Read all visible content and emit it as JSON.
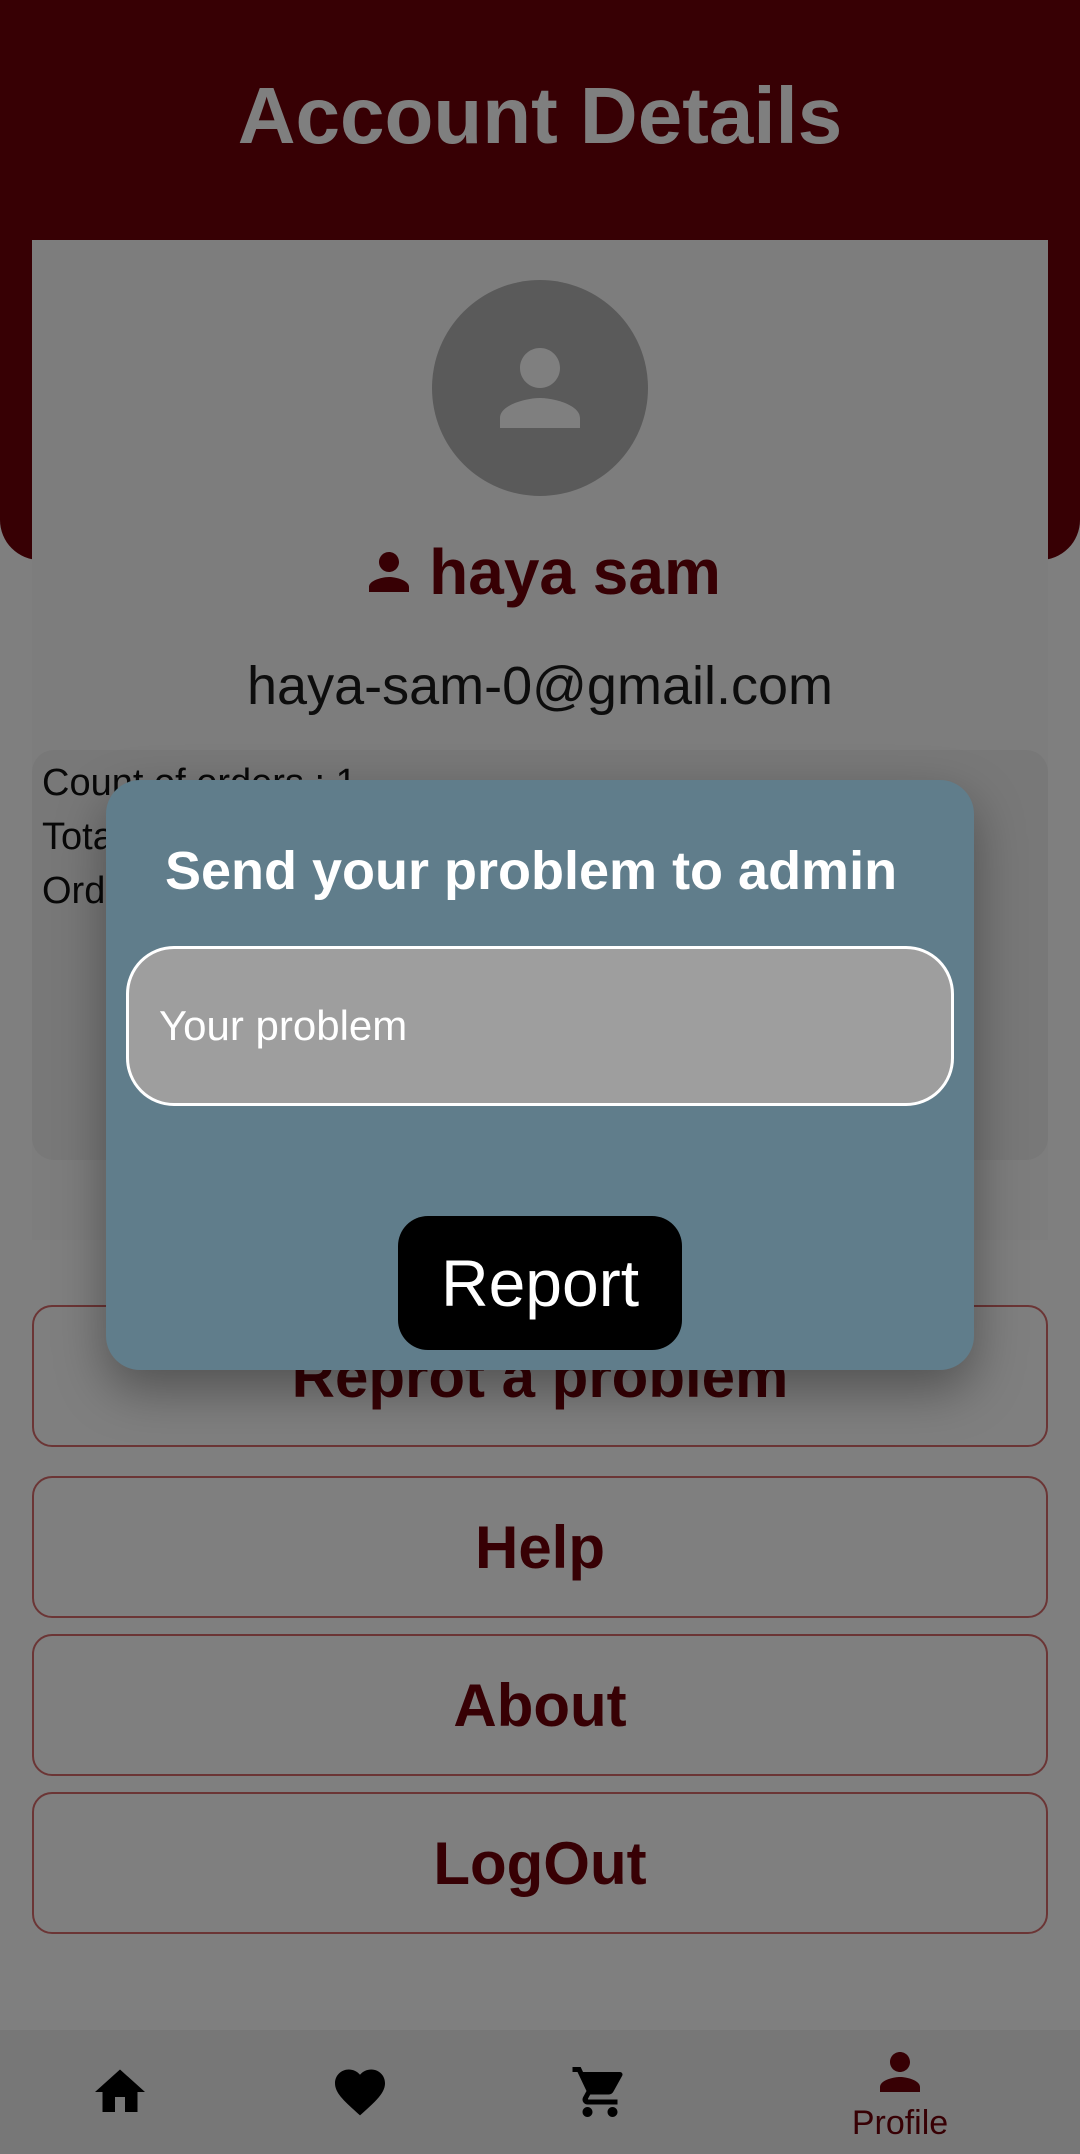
{
  "header": {
    "title": "Account Details"
  },
  "profile": {
    "name": "haya sam",
    "email": "haya-sam-0@gmail.com"
  },
  "stats": {
    "count_of_orders": "Count of orders : 1",
    "total_partial": "Tota",
    "orders_partial": "Ord"
  },
  "actions": {
    "report": "Reprot a problem",
    "help": "Help",
    "about": "About",
    "logout": "LogOut"
  },
  "bottom_nav": {
    "items": [
      {
        "icon": "home-icon",
        "label": ""
      },
      {
        "icon": "heart-icon",
        "label": ""
      },
      {
        "icon": "cart-icon",
        "label": ""
      },
      {
        "icon": "person-icon",
        "label": "Profile"
      }
    ],
    "active": "Profile"
  },
  "dialog": {
    "title": "Send your problem to admin",
    "input_placeholder": "Your problem",
    "submit_label": "Report"
  },
  "colors": {
    "brand": "#6f0008",
    "dialog_bg": "#607d8b",
    "input_bg": "#9e9e9e",
    "button_bg": "#000000"
  }
}
